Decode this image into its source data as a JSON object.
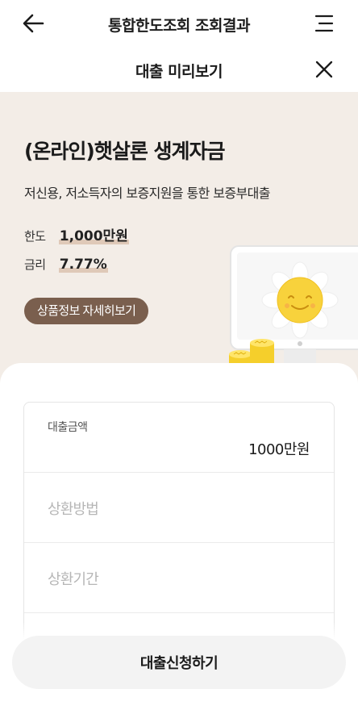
{
  "header": {
    "title": "통합한도조회 조회결과",
    "back_icon": "arrow-left-icon",
    "menu_icon": "menu-icon"
  },
  "subheader": {
    "title": "대출 미리보기",
    "close_icon": "close-icon"
  },
  "product": {
    "title": "(온라인)햇살론 생계자금",
    "description": "저신용, 저소득자의 보증지원을 통한 보증부대출",
    "limit_label": "한도",
    "limit_value": "1,000만원",
    "rate_label": "금리",
    "rate_value": "7.77%",
    "detail_button": "상품정보 자세히보기"
  },
  "form": {
    "amount_label": "대출금액",
    "amount_value": "1000만원",
    "method_placeholder": "상환방법",
    "period_placeholder": "상환기간"
  },
  "footer": {
    "apply_button": "대출신청하기"
  },
  "colors": {
    "hero_bg": "#f3ede7",
    "detail_btn_bg": "#7a5f4e",
    "highlight": "#dfc9b8",
    "sun": "#f8d23c",
    "coin": "#f5cf2b"
  }
}
